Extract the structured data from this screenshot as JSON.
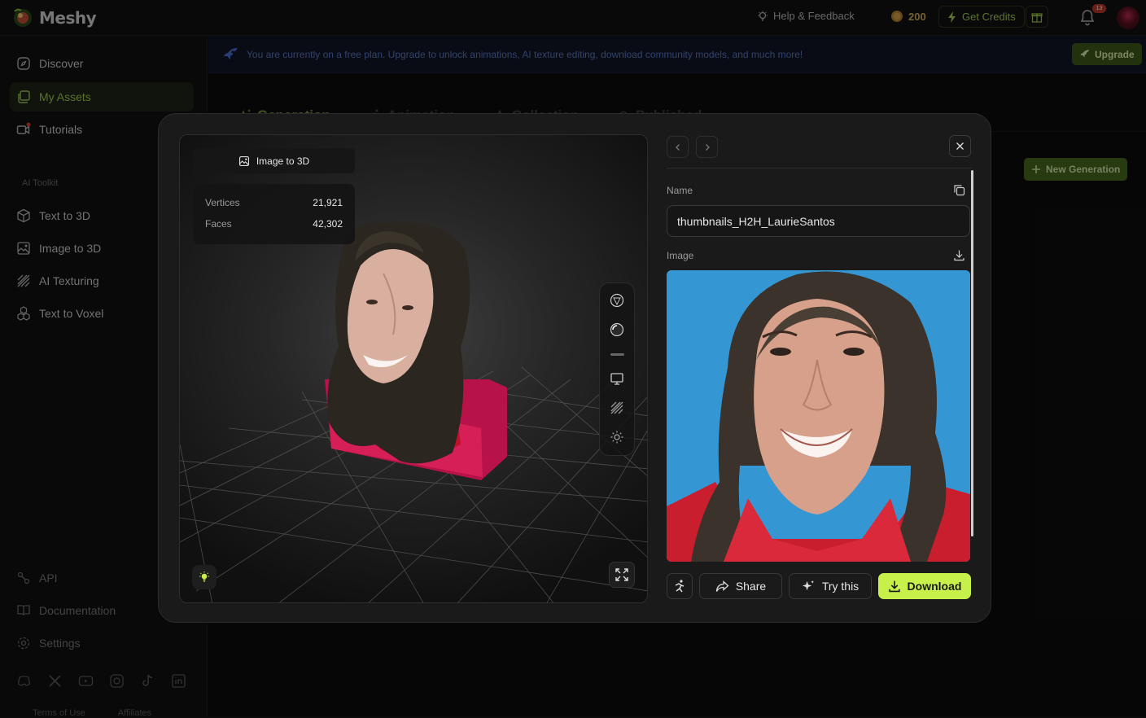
{
  "app": {
    "name": "Meshy"
  },
  "topbar": {
    "help_label": "Help & Feedback",
    "credits": "200",
    "get_credits_label": "Get Credits",
    "notification_count": "13"
  },
  "sidebar": {
    "items": [
      {
        "label": "Discover",
        "icon": "compass-icon"
      },
      {
        "label": "My Assets",
        "icon": "assets-icon",
        "active": true
      },
      {
        "label": "Tutorials",
        "icon": "video-icon"
      }
    ],
    "toolkit_label": "AI Toolkit",
    "toolkit_items": [
      {
        "label": "Text to 3D",
        "icon": "cube-icon"
      },
      {
        "label": "Image to 3D",
        "icon": "image-icon"
      },
      {
        "label": "AI Texturing",
        "icon": "texture-icon"
      },
      {
        "label": "Text to Voxel",
        "icon": "voxel-icon"
      }
    ],
    "bottom_items": [
      {
        "label": "API",
        "icon": "api-icon"
      },
      {
        "label": "Documentation",
        "icon": "book-icon"
      },
      {
        "label": "Settings",
        "icon": "gear-icon"
      }
    ],
    "footer_links": [
      "Terms of Use",
      "Affiliates"
    ]
  },
  "banner": {
    "text": "You are currently on a free plan. Upgrade to unlock animations, AI texture editing, download community models, and much more!",
    "upgrade_label": "Upgrade"
  },
  "tabs": [
    {
      "label": "Generation",
      "active": true
    },
    {
      "label": "Animation"
    },
    {
      "label": "Collection"
    },
    {
      "label": "Published"
    }
  ],
  "new_generation_label": "New Generation",
  "modal": {
    "viewer": {
      "type_label": "Image to 3D",
      "stats": [
        {
          "label": "Vertices",
          "value": "21,921"
        },
        {
          "label": "Faces",
          "value": "42,302"
        }
      ]
    },
    "name_label": "Name",
    "name_value": "thumbnails_H2H_LaurieSantos",
    "image_label": "Image",
    "actions": {
      "share": "Share",
      "try_this": "Try this",
      "download": "Download"
    }
  },
  "colors": {
    "accent": "#c8f04a",
    "active_nav": "#a3cf4a",
    "banner_text": "#5b79c4"
  }
}
